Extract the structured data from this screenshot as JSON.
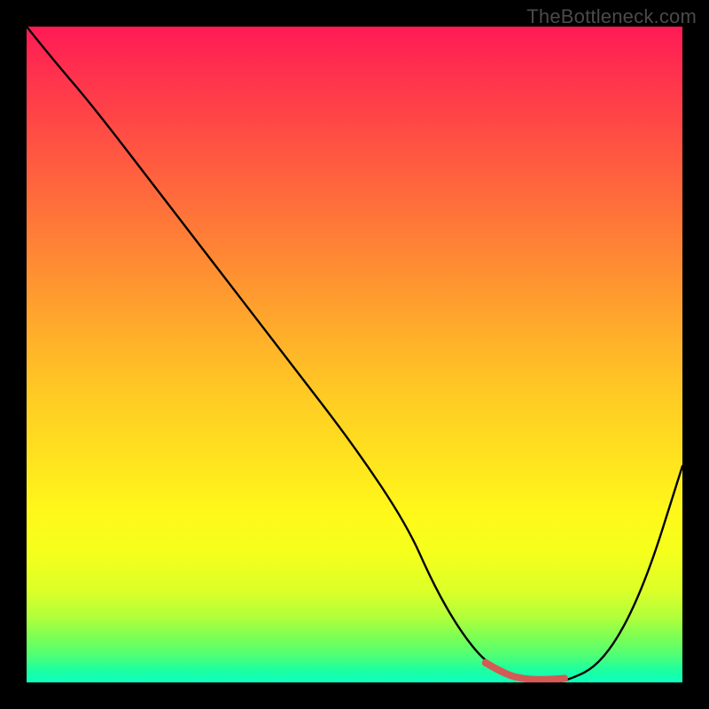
{
  "attribution": "TheBottleneck.com",
  "chart_data": {
    "type": "line",
    "title": "",
    "xlabel": "",
    "ylabel": "",
    "xlim": [
      0,
      100
    ],
    "ylim": [
      0,
      100
    ],
    "series": [
      {
        "name": "bottleneck-curve",
        "x": [
          0,
          4,
          10,
          20,
          30,
          40,
          50,
          58,
          62,
          66,
          70,
          74,
          78,
          82,
          88,
          94,
          100
        ],
        "values": [
          100,
          95,
          88,
          75,
          62,
          49,
          36,
          24,
          15,
          8,
          3,
          1,
          0,
          0,
          3,
          14,
          33
        ]
      }
    ],
    "highlight": {
      "name": "optimal-range",
      "x": [
        70,
        73,
        76,
        79,
        82
      ],
      "values": [
        3,
        1.2,
        0.5,
        0.4,
        0.6
      ],
      "color": "#d45a55"
    },
    "gradient_stops": [
      {
        "pos": 0,
        "color": "#ff1a55"
      },
      {
        "pos": 50,
        "color": "#ffca24"
      },
      {
        "pos": 80,
        "color": "#fff81a"
      },
      {
        "pos": 100,
        "color": "#0fffc0"
      }
    ]
  }
}
